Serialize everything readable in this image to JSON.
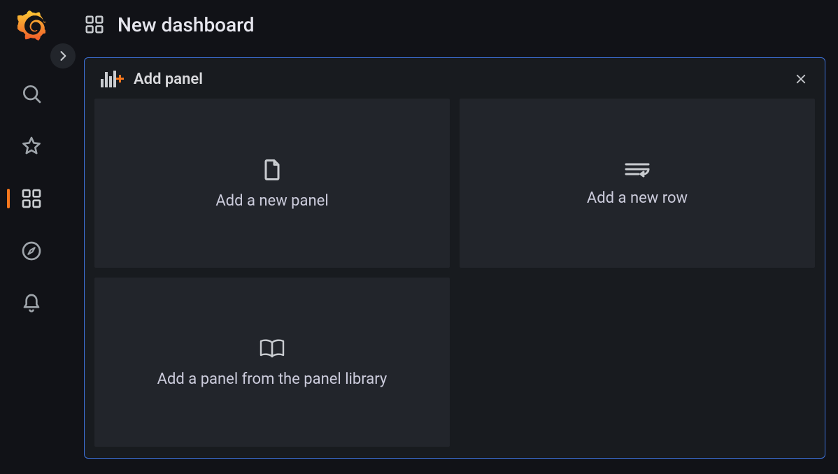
{
  "sidebar": {
    "items": [
      {
        "name": "search"
      },
      {
        "name": "starred"
      },
      {
        "name": "dashboards",
        "active": true
      },
      {
        "name": "explore"
      },
      {
        "name": "alerts"
      }
    ]
  },
  "topbar": {
    "title": "New dashboard"
  },
  "panel": {
    "title": "Add panel",
    "cards": [
      {
        "label": "Add a new panel"
      },
      {
        "label": "Add a new row"
      },
      {
        "label": "Add a panel from the panel library"
      }
    ]
  }
}
